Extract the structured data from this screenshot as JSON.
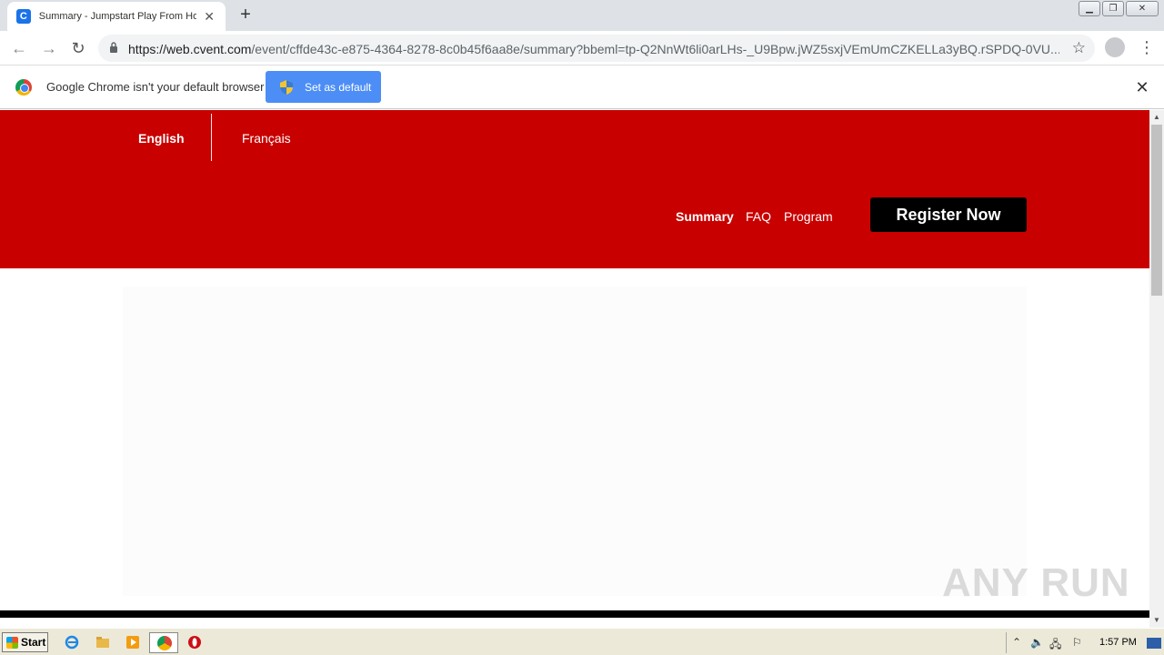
{
  "browser": {
    "tab_title": "Summary - Jumpstart Play From Hom",
    "tab_favicon_letter": "C",
    "url_host": "https://web.cvent.com",
    "url_path": "/event/cffde43c-e875-4364-8278-8c0b45f6aa8e/summary?bbeml=tp-Q2NnWt6li0arLHs-_U9Bpw.jWZ5sxjVEmUmCZKELLa3yBQ.rSPDQ-0VU...",
    "new_tab": "+",
    "close_tab": "✕"
  },
  "infobar": {
    "message": "Google Chrome isn't your default browser",
    "button_label": "Set as default",
    "close": "✕"
  },
  "site": {
    "languages": [
      "English",
      "Français"
    ],
    "nav": {
      "summary": "Summary",
      "faq": "FAQ",
      "program": "Program"
    },
    "register_label": "Register Now",
    "watermark": "ANY RUN"
  },
  "taskbar": {
    "start_label": "Start",
    "clock": "1:57 PM"
  },
  "colors": {
    "hero_red": "#c90000",
    "set_default_blue": "#4c8ef5",
    "register_black": "#000000"
  },
  "icons": [
    "back-icon",
    "forward-icon",
    "reload-icon",
    "lock-icon",
    "star-icon",
    "profile-icon",
    "menu-icon",
    "chrome-icon",
    "shield-icon",
    "close-icon",
    "ie-icon",
    "folder-icon",
    "media-icon",
    "opera-icon"
  ]
}
